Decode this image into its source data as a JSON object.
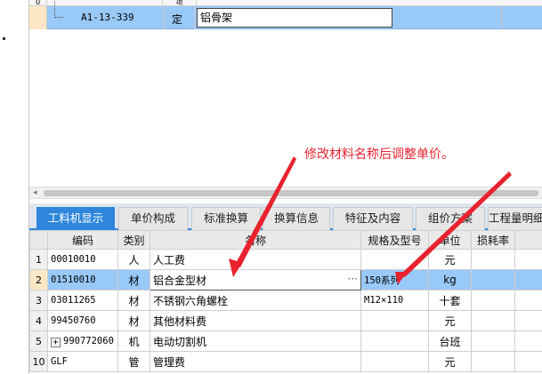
{
  "top_grid": {
    "partial_row": {
      "index": "0",
      "type": "项"
    },
    "selected_row": {
      "code": "A1-13-339",
      "kind": "定",
      "name_value": "铝骨架"
    }
  },
  "annotation": {
    "text": "修改材料名称后调整单价。"
  },
  "tabs": [
    {
      "label": "工料机显示",
      "active": true
    },
    {
      "label": "单价构成"
    },
    {
      "label": "标准换算"
    },
    {
      "label": "换算信息"
    },
    {
      "label": "特征及内容"
    },
    {
      "label": "组价方案"
    },
    {
      "label": "工程量明细"
    }
  ],
  "table": {
    "headers": [
      "",
      "编码",
      "类别",
      "名称",
      "规格及型号",
      "单位",
      "损耗率"
    ],
    "rows": [
      {
        "no": "1",
        "code": "00010010",
        "cat": "人",
        "name": "人工费",
        "spec": "",
        "unit": "元",
        "loss": ""
      },
      {
        "no": "2",
        "code": "01510010",
        "cat": "材",
        "name": "铝合金型材",
        "spec": "150系列",
        "unit": "kg",
        "loss": "",
        "selected": true,
        "name_button": "···"
      },
      {
        "no": "3",
        "code": "03011265",
        "cat": "材",
        "name": "不锈钢六角螺栓",
        "spec": "M12×110",
        "unit": "十套",
        "loss": ""
      },
      {
        "no": "4",
        "code": "99450760",
        "cat": "材",
        "name": "其他材料费",
        "spec": "",
        "unit": "元",
        "loss": ""
      },
      {
        "no": "5",
        "code": "990772060",
        "expand": "+",
        "cat": "机",
        "name": "电动切割机",
        "spec": "",
        "unit": "台班",
        "loss": ""
      },
      {
        "no": "10",
        "code": "GLF",
        "cat": "管",
        "name": "管理费",
        "spec": "",
        "unit": "元",
        "loss": ""
      }
    ]
  },
  "colors": {
    "selection": "#99c9f7",
    "row_marker": "#fde7c6",
    "tab_active": "#2f86dc",
    "annotation": "#e8222e"
  },
  "icons": {
    "scroll_left": "left-arrow-icon",
    "expand": "plus-box-icon",
    "ellipsis": "ellipsis-icon"
  }
}
